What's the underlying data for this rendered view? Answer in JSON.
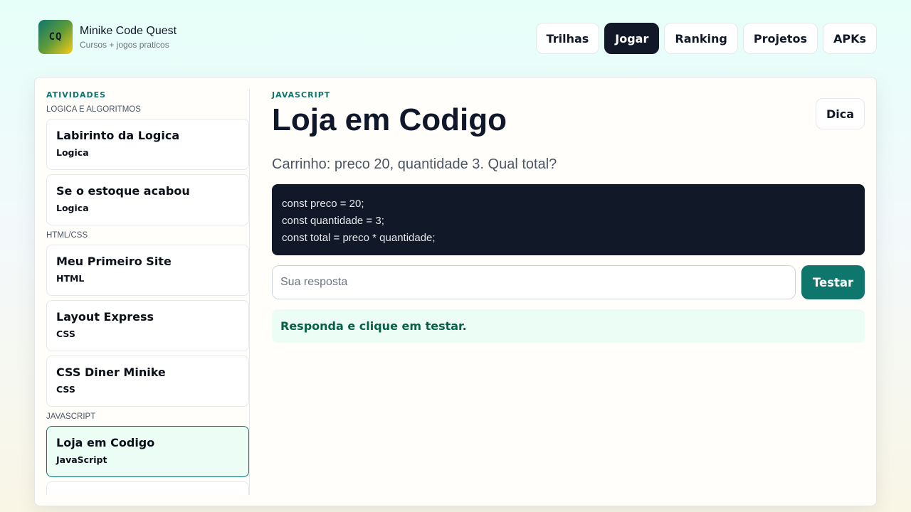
{
  "brand": {
    "logo_text": "CQ",
    "title": "Minike Code Quest",
    "subtitle": "Cursos + jogos praticos"
  },
  "nav": {
    "items": [
      {
        "label": "Trilhas",
        "active": false
      },
      {
        "label": "Jogar",
        "active": true
      },
      {
        "label": "Ranking",
        "active": false
      },
      {
        "label": "Projetos",
        "active": false
      },
      {
        "label": "APKs",
        "active": false
      }
    ]
  },
  "sidebar": {
    "heading": "ATIVIDADES",
    "groups": [
      {
        "label": "LOGICA E ALGORITMOS",
        "items": [
          {
            "title": "Labirinto da Logica",
            "tag": "Logica"
          },
          {
            "title": "Se o estoque acabou",
            "tag": "Logica"
          }
        ]
      },
      {
        "label": "HTML/CSS",
        "items": [
          {
            "title": "Meu Primeiro Site",
            "tag": "HTML"
          },
          {
            "title": "Layout Express",
            "tag": "CSS"
          },
          {
            "title": "CSS Diner Minike",
            "tag": "CSS"
          }
        ]
      },
      {
        "label": "JAVASCRIPT",
        "items": [
          {
            "title": "Loja em Codigo",
            "tag": "JavaScript",
            "active": true
          }
        ]
      }
    ]
  },
  "main": {
    "language": "JAVASCRIPT",
    "title": "Loja em Codigo",
    "hint_label": "Dica",
    "question": "Carrinho: preco 20, quantidade 3. Qual total?",
    "code_lines": [
      "const preco = 20;",
      "const quantidade = 3;",
      "const total = preco * quantidade;"
    ],
    "answer": {
      "value": "",
      "placeholder": "Sua resposta"
    },
    "test_label": "Testar",
    "feedback": "Responda e clique em testar."
  },
  "colors": {
    "accent": "#0f766e",
    "dark": "#111827",
    "feedback_bg": "#ecfdf6"
  }
}
